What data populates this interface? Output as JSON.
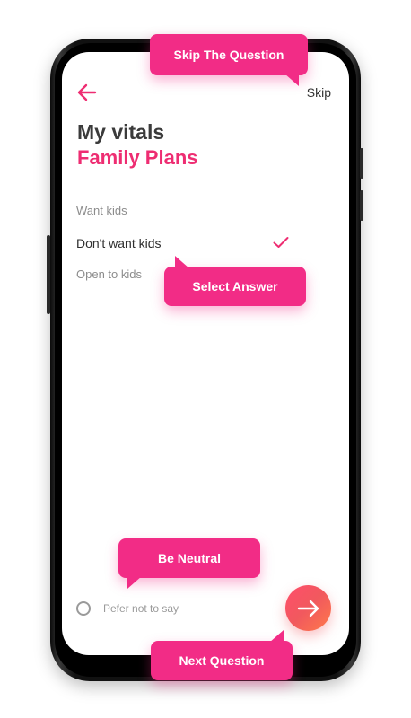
{
  "header": {
    "back_icon": "arrow-left-icon",
    "skip_label": "Skip"
  },
  "page": {
    "title": "My vitals",
    "subtitle": "Family Plans"
  },
  "options": [
    {
      "label": "Want kids",
      "selected": false
    },
    {
      "label": "Don't want kids",
      "selected": true
    },
    {
      "label": "Open to kids",
      "selected": false
    }
  ],
  "footer": {
    "prefer_label": "Pefer not to say",
    "next_icon": "arrow-right-icon"
  },
  "callouts": {
    "skip": "Skip The Question",
    "select": "Select Answer",
    "neutral": "Be Neutral",
    "next": "Next Question"
  },
  "colors": {
    "accent": "#ee2d72",
    "callout": "#f22c86",
    "next_gradient_start": "#ff4d6b",
    "next_gradient_end": "#ff7a4a"
  }
}
